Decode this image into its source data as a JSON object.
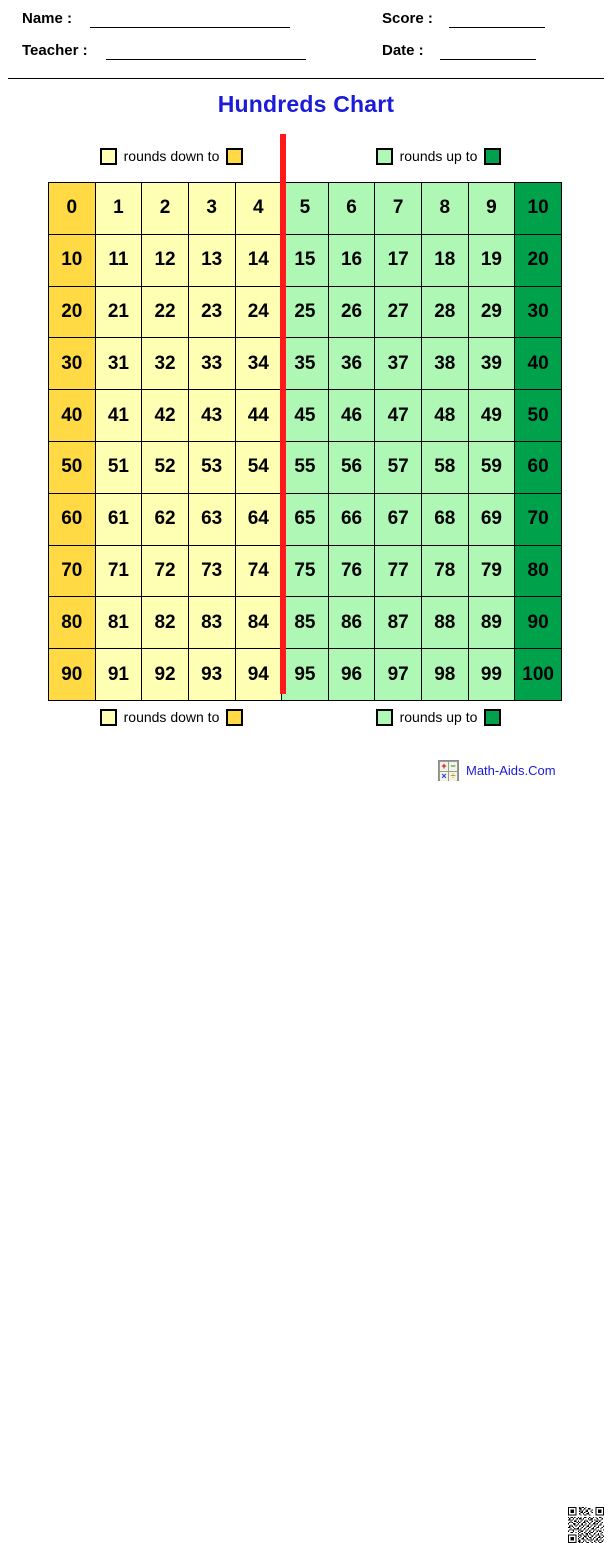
{
  "header": {
    "fields": [
      {
        "label": "Name :",
        "value": "",
        "blank": "long"
      },
      {
        "label": "Teacher :",
        "value": "",
        "blank": "long"
      },
      {
        "label": "Score :",
        "value": "",
        "blank": "short"
      },
      {
        "label": "Date :",
        "value": "",
        "blank": "short"
      }
    ]
  },
  "title": "Hundreds Chart",
  "legend": {
    "rounds_down_label": "rounds down to",
    "rounds_up_label": "rounds up to",
    "colors": {
      "rounds_down_from": "#FFFFB3",
      "rounds_down_to": "#FFDA44",
      "rounds_up_from": "#AEF7B4",
      "rounds_up_to": "#00A14B",
      "divider": "#FF1A1A",
      "title": "#1b1bd8"
    }
  },
  "chart_data": {
    "type": "table",
    "title": "Hundreds Chart",
    "rows": 10,
    "columns": 11,
    "values": [
      [
        0,
        1,
        2,
        3,
        4,
        5,
        6,
        7,
        8,
        9,
        10
      ],
      [
        10,
        11,
        12,
        13,
        14,
        15,
        16,
        17,
        18,
        19,
        20
      ],
      [
        20,
        21,
        22,
        23,
        24,
        25,
        26,
        27,
        28,
        29,
        30
      ],
      [
        30,
        31,
        32,
        33,
        34,
        35,
        36,
        37,
        38,
        39,
        40
      ],
      [
        40,
        41,
        42,
        43,
        44,
        45,
        46,
        47,
        48,
        49,
        50
      ],
      [
        50,
        51,
        52,
        53,
        54,
        55,
        56,
        57,
        58,
        59,
        60
      ],
      [
        60,
        61,
        62,
        63,
        64,
        65,
        66,
        67,
        68,
        69,
        70
      ],
      [
        70,
        71,
        72,
        73,
        74,
        75,
        76,
        77,
        78,
        79,
        80
      ],
      [
        80,
        81,
        82,
        83,
        84,
        85,
        86,
        87,
        88,
        89,
        90
      ],
      [
        90,
        91,
        92,
        93,
        94,
        95,
        96,
        97,
        98,
        99,
        100
      ]
    ],
    "cell_categories": [
      [
        "rounds-down-target",
        "rounds-down",
        "rounds-down",
        "rounds-down",
        "rounds-down",
        "rounds-up",
        "rounds-up",
        "rounds-up",
        "rounds-up",
        "rounds-up",
        "rounds-up-target"
      ]
    ],
    "divider_after_column": 5
  },
  "footer": {
    "brand": "Math-Aids.Com",
    "icon": "calculator-icon",
    "calc_keys": [
      "+",
      "−",
      "×",
      "÷"
    ],
    "qr": "qr-code"
  }
}
